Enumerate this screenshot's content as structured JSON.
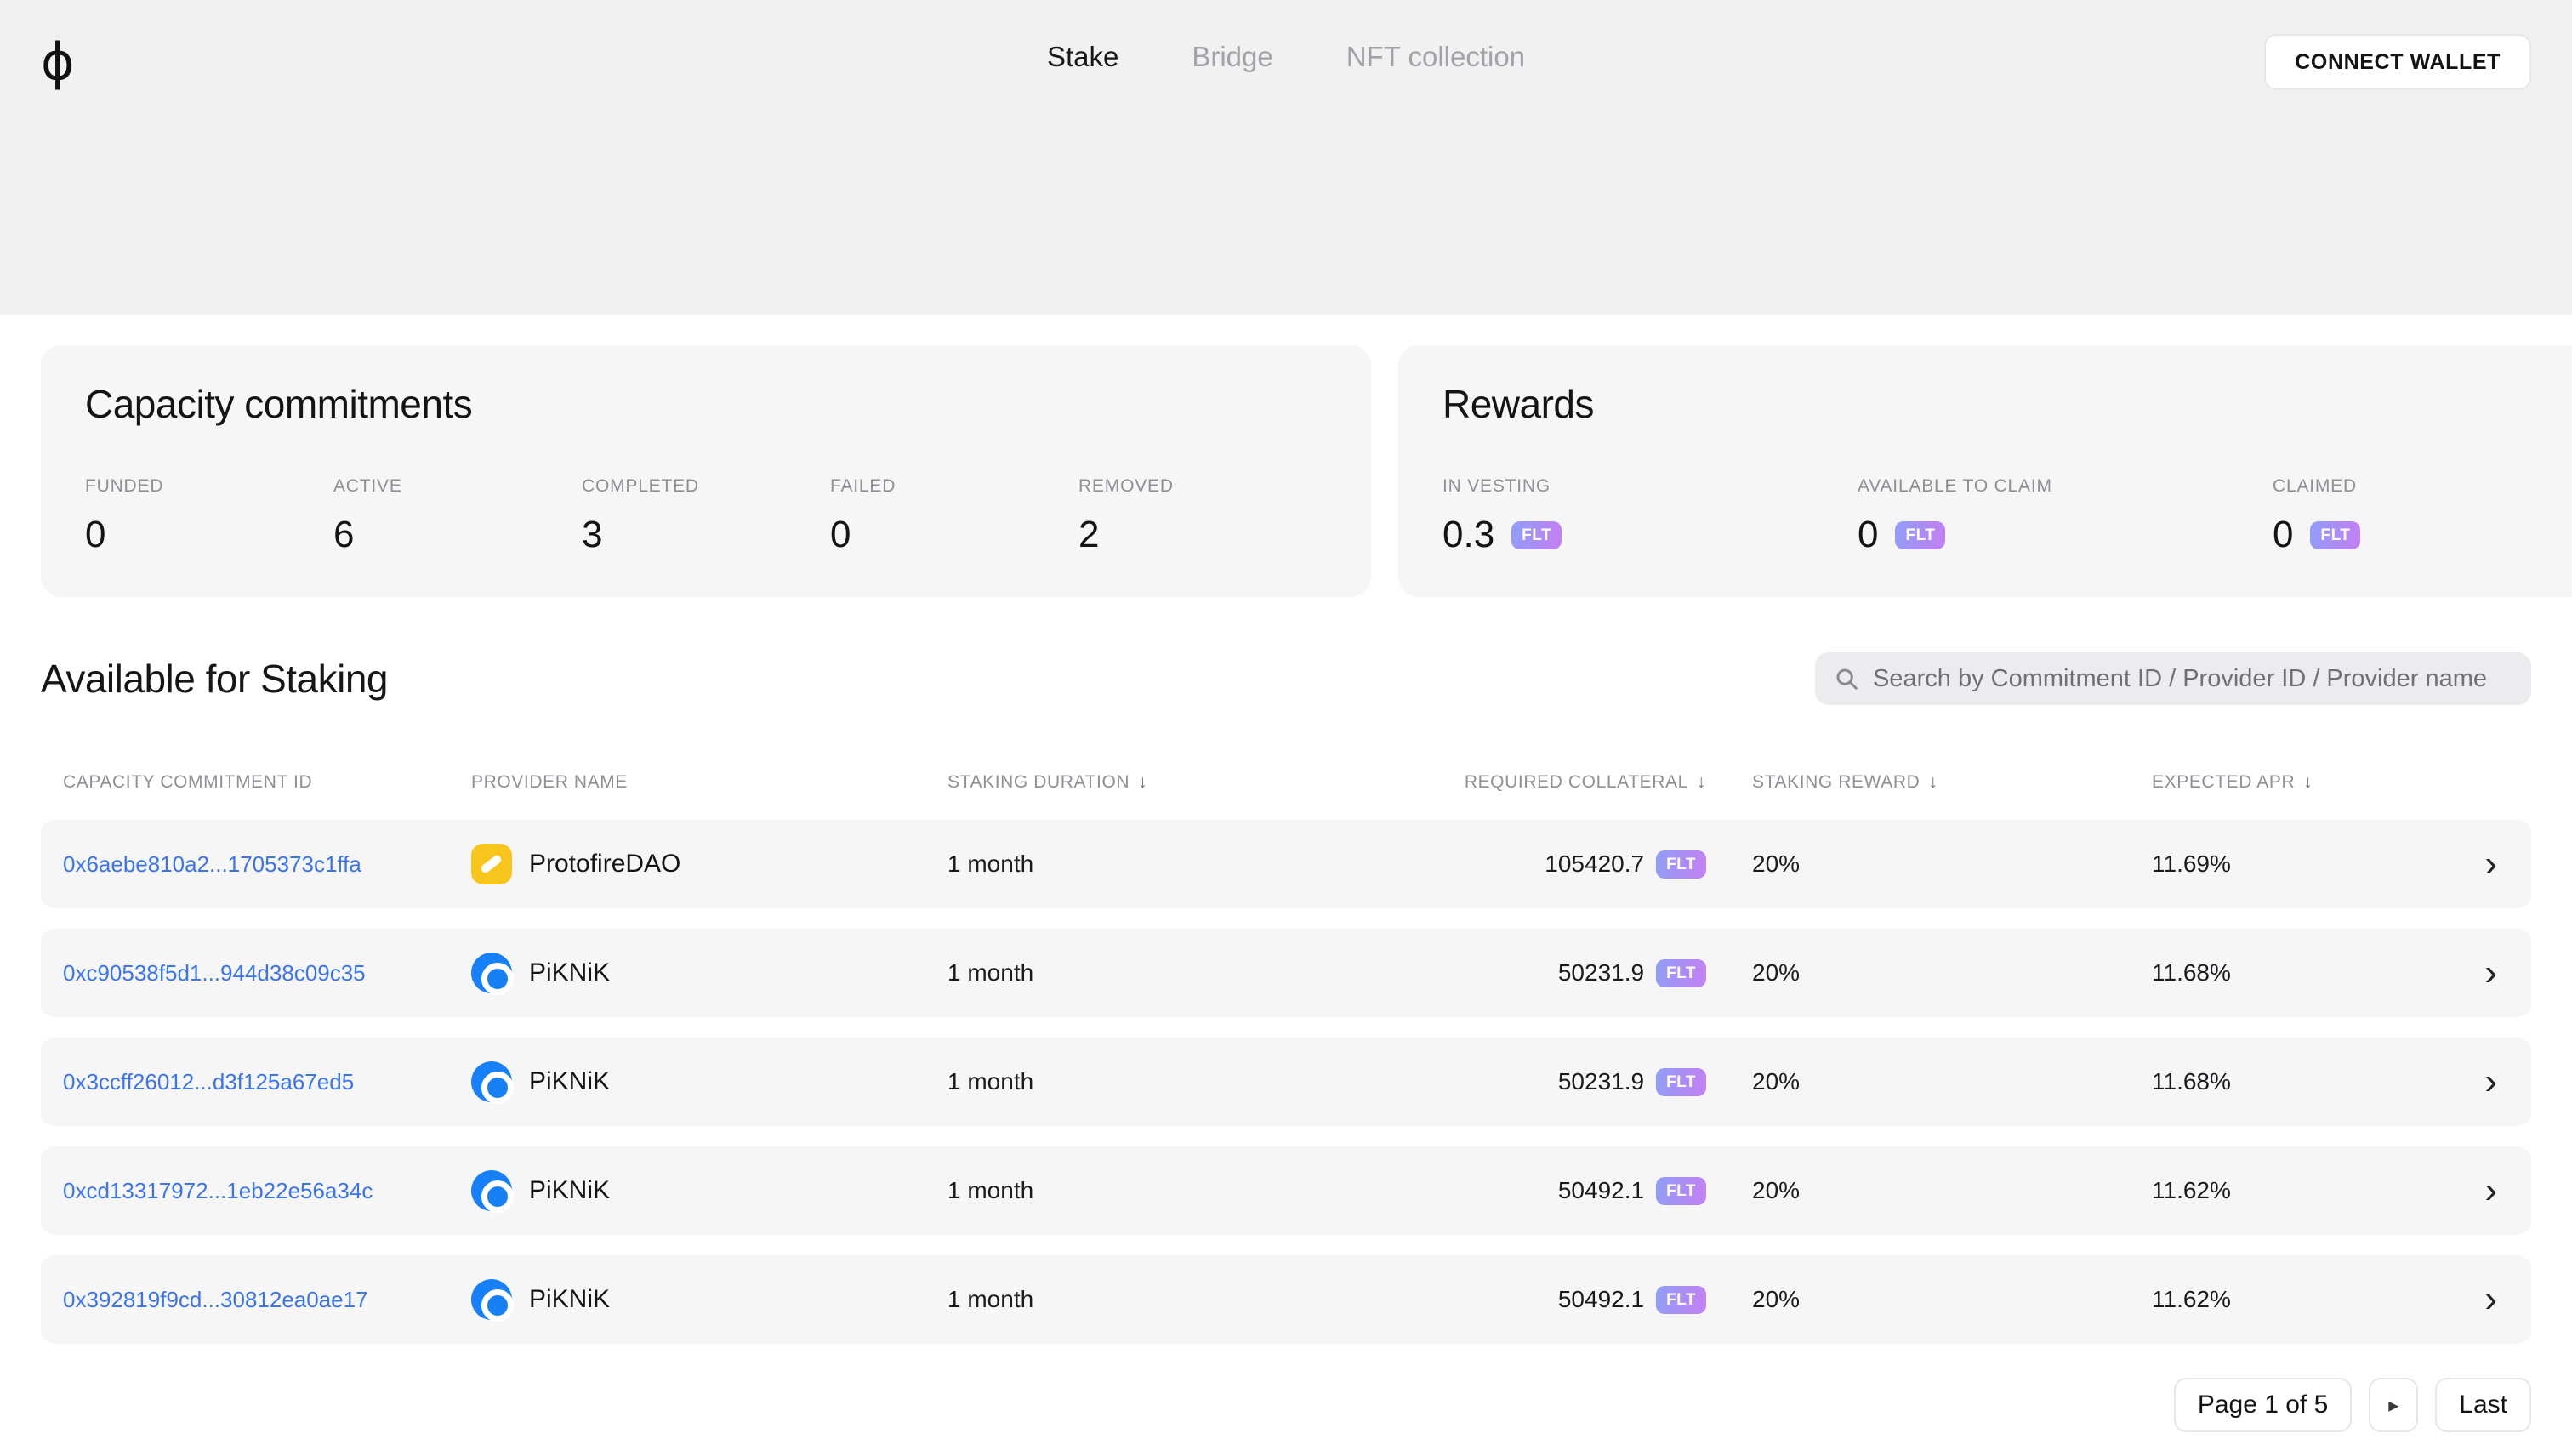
{
  "nav": {
    "logo": "ϕ",
    "tabs": [
      {
        "label": "Stake"
      },
      {
        "label": "Bridge"
      },
      {
        "label": "NFT collection"
      }
    ],
    "connect_wallet": "CONNECT WALLET"
  },
  "capacity": {
    "title": "Capacity commitments",
    "stats": [
      {
        "label": "FUNDED",
        "value": "0"
      },
      {
        "label": "ACTIVE",
        "value": "6"
      },
      {
        "label": "COMPLETED",
        "value": "3"
      },
      {
        "label": "FAILED",
        "value": "0"
      },
      {
        "label": "REMOVED",
        "value": "2"
      }
    ]
  },
  "rewards": {
    "title": "Rewards",
    "stats": [
      {
        "label": "IN VESTING",
        "value": "0.3",
        "token": "FLT"
      },
      {
        "label": "AVAILABLE TO CLAIM",
        "value": "0",
        "token": "FLT"
      },
      {
        "label": "CLAIMED",
        "value": "0",
        "token": "FLT"
      }
    ]
  },
  "staking": {
    "title": "Available for Staking",
    "search_placeholder": "Search by Commitment ID / Provider ID / Provider name",
    "columns": [
      {
        "label": "CAPACITY COMMITMENT ID",
        "sortable": false
      },
      {
        "label": "PROVIDER NAME",
        "sortable": false
      },
      {
        "label": "STAKING DURATION",
        "sortable": true
      },
      {
        "label": "REQUIRED COLLATERAL",
        "sortable": true
      },
      {
        "label": "STAKING REWARD",
        "sortable": true
      },
      {
        "label": "EXPECTED APR",
        "sortable": true
      }
    ],
    "rows": [
      {
        "id": "0x6aebe810a2...1705373c1ffa",
        "provider": "ProtofireDAO",
        "icon": "protofire",
        "duration": "1 month",
        "collateral": "105420.7",
        "token": "FLT",
        "reward": "20%",
        "apr": "11.69%"
      },
      {
        "id": "0xc90538f5d1...944d38c09c35",
        "provider": "PiKNiK",
        "icon": "piknik",
        "duration": "1 month",
        "collateral": "50231.9",
        "token": "FLT",
        "reward": "20%",
        "apr": "11.68%"
      },
      {
        "id": "0x3ccff26012...d3f125a67ed5",
        "provider": "PiKNiK",
        "icon": "piknik",
        "duration": "1 month",
        "collateral": "50231.9",
        "token": "FLT",
        "reward": "20%",
        "apr": "11.68%"
      },
      {
        "id": "0xcd13317972...1eb22e56a34c",
        "provider": "PiKNiK",
        "icon": "piknik",
        "duration": "1 month",
        "collateral": "50492.1",
        "token": "FLT",
        "reward": "20%",
        "apr": "11.62%"
      },
      {
        "id": "0x392819f9cd...30812ea0ae17",
        "provider": "PiKNiK",
        "icon": "piknik",
        "duration": "1 month",
        "collateral": "50492.1",
        "token": "FLT",
        "reward": "20%",
        "apr": "11.62%"
      }
    ]
  },
  "pagination": {
    "page_label": "Page 1 of 5",
    "last_label": "Last"
  },
  "icons": {
    "sort": "↓",
    "chevron": "›",
    "next": "▸"
  }
}
